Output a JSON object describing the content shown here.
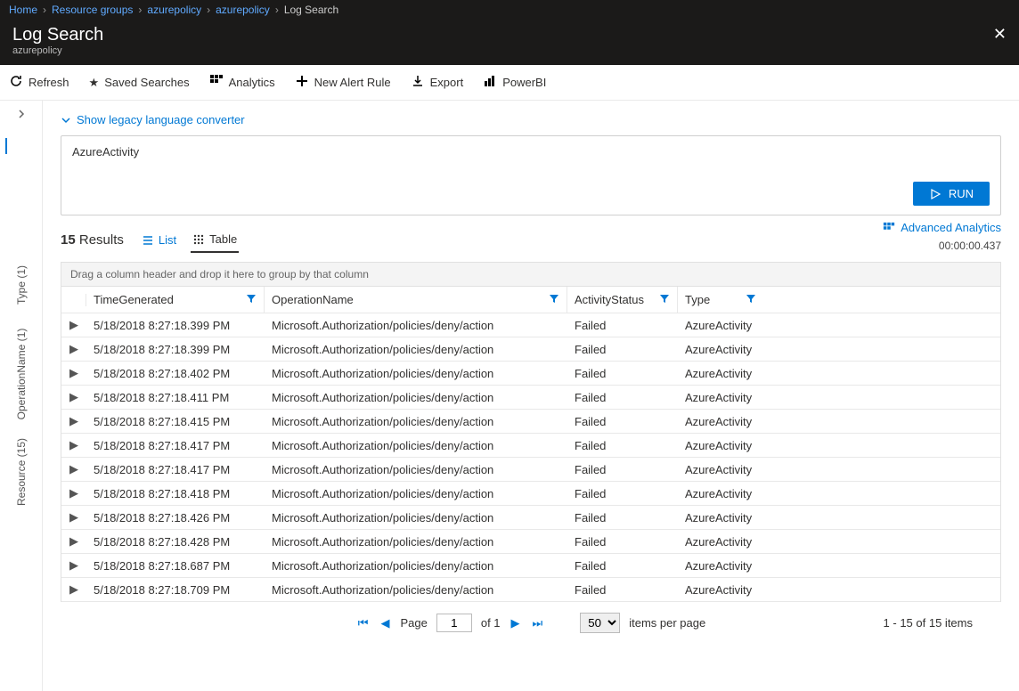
{
  "breadcrumbs": [
    "Home",
    "Resource groups",
    "azurepolicy",
    "azurepolicy",
    "Log Search"
  ],
  "header": {
    "title": "Log Search",
    "subtitle": "azurepolicy"
  },
  "toolbar": {
    "refresh": "Refresh",
    "saved": "Saved Searches",
    "analytics": "Analytics",
    "alert": "New Alert Rule",
    "export": "Export",
    "powerbi": "PowerBI"
  },
  "rail": {
    "type": "Type (1)",
    "operation": "OperationName (1)",
    "resource": "Resource (15)"
  },
  "legacy_link": "Show legacy language converter",
  "query": {
    "text": "AzureActivity",
    "run": "RUN"
  },
  "advanced": {
    "label": "Advanced Analytics",
    "timing": "00:00:00.437"
  },
  "results": {
    "count": "15",
    "label": "Results",
    "list": "List",
    "table": "Table"
  },
  "group_hint": "Drag a column header and drop it here to group by that column",
  "columns": {
    "time": "TimeGenerated",
    "op": "OperationName",
    "status": "ActivityStatus",
    "type": "Type"
  },
  "rows": [
    {
      "time": "5/18/2018 8:27:18.399 PM",
      "op": "Microsoft.Authorization/policies/deny/action",
      "status": "Failed",
      "type": "AzureActivity"
    },
    {
      "time": "5/18/2018 8:27:18.399 PM",
      "op": "Microsoft.Authorization/policies/deny/action",
      "status": "Failed",
      "type": "AzureActivity"
    },
    {
      "time": "5/18/2018 8:27:18.402 PM",
      "op": "Microsoft.Authorization/policies/deny/action",
      "status": "Failed",
      "type": "AzureActivity"
    },
    {
      "time": "5/18/2018 8:27:18.411 PM",
      "op": "Microsoft.Authorization/policies/deny/action",
      "status": "Failed",
      "type": "AzureActivity"
    },
    {
      "time": "5/18/2018 8:27:18.415 PM",
      "op": "Microsoft.Authorization/policies/deny/action",
      "status": "Failed",
      "type": "AzureActivity"
    },
    {
      "time": "5/18/2018 8:27:18.417 PM",
      "op": "Microsoft.Authorization/policies/deny/action",
      "status": "Failed",
      "type": "AzureActivity"
    },
    {
      "time": "5/18/2018 8:27:18.417 PM",
      "op": "Microsoft.Authorization/policies/deny/action",
      "status": "Failed",
      "type": "AzureActivity"
    },
    {
      "time": "5/18/2018 8:27:18.418 PM",
      "op": "Microsoft.Authorization/policies/deny/action",
      "status": "Failed",
      "type": "AzureActivity"
    },
    {
      "time": "5/18/2018 8:27:18.426 PM",
      "op": "Microsoft.Authorization/policies/deny/action",
      "status": "Failed",
      "type": "AzureActivity"
    },
    {
      "time": "5/18/2018 8:27:18.428 PM",
      "op": "Microsoft.Authorization/policies/deny/action",
      "status": "Failed",
      "type": "AzureActivity"
    },
    {
      "time": "5/18/2018 8:27:18.687 PM",
      "op": "Microsoft.Authorization/policies/deny/action",
      "status": "Failed",
      "type": "AzureActivity"
    },
    {
      "time": "5/18/2018 8:27:18.709 PM",
      "op": "Microsoft.Authorization/policies/deny/action",
      "status": "Failed",
      "type": "AzureActivity"
    }
  ],
  "pager": {
    "page_label": "Page",
    "page": "1",
    "of_label": "of 1",
    "per_page": "50",
    "per_page_label": "items per page",
    "summary": "1 - 15 of 15 items"
  }
}
